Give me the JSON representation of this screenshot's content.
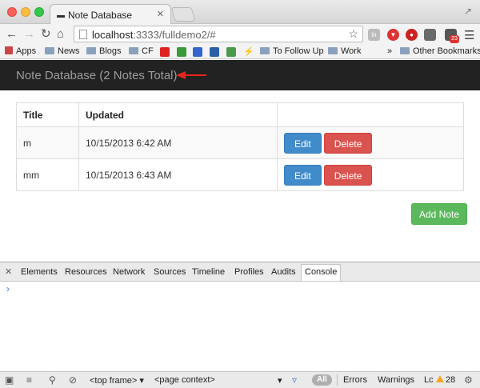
{
  "browser": {
    "tab_title": "Note Database",
    "url_host": "localhost",
    "url_rest": ":3333/fulldemo2/#",
    "bookmarks": [
      "Apps",
      "News",
      "Blogs",
      "CF",
      "To Follow Up",
      "Work",
      "Other Bookmarks"
    ],
    "bookmarks_more": "»",
    "badge_count": "23"
  },
  "app": {
    "brand": "Note Database (2 Notes Total)",
    "arrow_color": "#e8251b",
    "columns": [
      "Title",
      "Updated",
      ""
    ],
    "notes": [
      {
        "title": "m",
        "updated": "10/15/2013 6:42 AM"
      },
      {
        "title": "mm",
        "updated": "10/15/2013 6:43 AM"
      }
    ],
    "edit_label": "Edit",
    "delete_label": "Delete",
    "add_label": "Add Note",
    "colors": {
      "edit": "#428bca",
      "delete": "#d9534f",
      "add": "#5cb85c",
      "navbar": "#222222"
    }
  },
  "devtools": {
    "tabs": [
      "Elements",
      "Resources",
      "Network",
      "Sources",
      "Timeline",
      "Profiles",
      "Audits",
      "Console"
    ],
    "active_tab": "Console",
    "prompt": "›",
    "frame_select": "<top frame>",
    "context_select": "<page context>",
    "filter_all": "All",
    "filters": [
      "Errors",
      "Warnings",
      "Lc"
    ],
    "warning_count": "28"
  }
}
